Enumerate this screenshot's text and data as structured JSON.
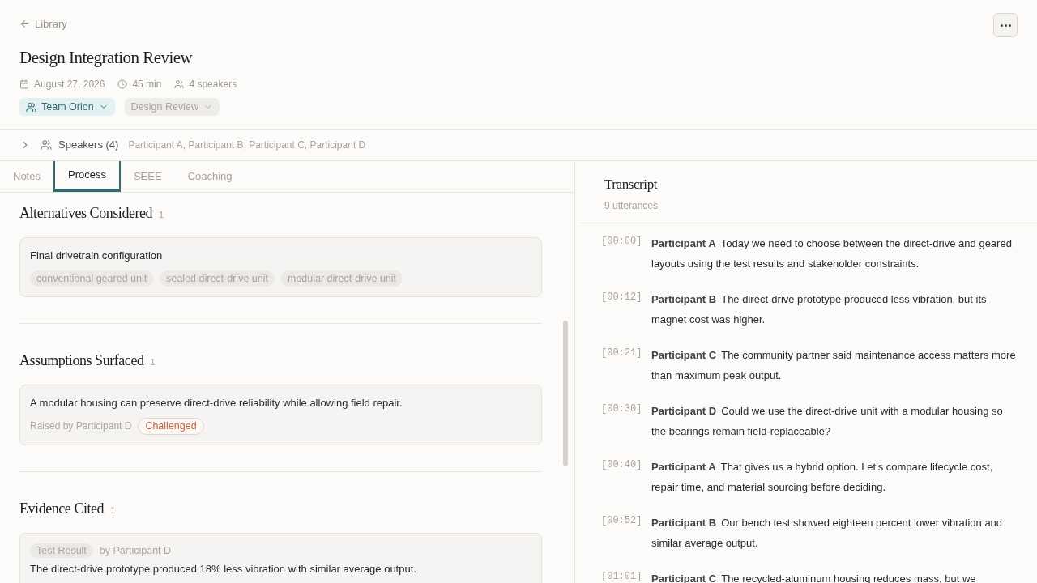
{
  "back_link": "Library",
  "title": "Design Integration Review",
  "meta": {
    "date": "August 27, 2026",
    "duration": "45 min",
    "speakers": "4 speakers"
  },
  "tags": [
    {
      "kind": "team",
      "label": "Team Orion"
    },
    {
      "kind": "type",
      "label": "Design Review"
    }
  ],
  "speakers_row": {
    "expanded": false,
    "label": "Speakers (4)",
    "names": "Participant A, Participant B, Participant C, Participant D"
  },
  "tabs": [
    {
      "label": "Notes",
      "selected": false
    },
    {
      "label": "Process",
      "selected": true
    },
    {
      "label": "SEEE",
      "selected": false
    },
    {
      "label": "Coaching",
      "selected": false
    }
  ],
  "sections": [
    {
      "kind": "alternatives",
      "title": "Alternatives Considered",
      "count": "1",
      "items": [
        {
          "text": "Final drivetrain configuration",
          "options": [
            "conventional geared unit",
            "sealed direct-drive unit",
            "modular direct-drive unit"
          ]
        }
      ]
    },
    {
      "kind": "assumptions",
      "title": "Assumptions Surfaced",
      "count": "1",
      "items": [
        {
          "text": "A modular housing can preserve direct-drive reliability while allowing field repair.",
          "raised_by": "Raised by Participant D",
          "status": "Challenged"
        }
      ]
    },
    {
      "kind": "evidence",
      "title": "Evidence Cited",
      "count": "1",
      "items": [
        {
          "tag": "Test Result",
          "by": "by Participant D",
          "text": "The direct-drive prototype produced 18% less vibration with similar average output."
        }
      ]
    }
  ],
  "transcript": {
    "title": "Transcript",
    "subtitle": "9 utterances",
    "utterances": [
      {
        "time": "[00:00]",
        "speaker": "Participant A",
        "text": "Today we need to choose between the direct-drive and geared layouts using the test results and stakeholder constraints."
      },
      {
        "time": "[00:12]",
        "speaker": "Participant B",
        "text": "The direct-drive prototype produced less vibration, but its magnet cost was higher."
      },
      {
        "time": "[00:21]",
        "speaker": "Participant C",
        "text": "The community partner said maintenance access matters more than maximum peak output."
      },
      {
        "time": "[00:30]",
        "speaker": "Participant D",
        "text": "Could we use the direct-drive unit with a modular housing so the bearings remain field-replaceable?"
      },
      {
        "time": "[00:40]",
        "speaker": "Participant A",
        "text": "That gives us a hybrid option. Let's compare lifecycle cost, repair time, and material sourcing before deciding."
      },
      {
        "time": "[00:52]",
        "speaker": "Participant B",
        "text": "Our bench test showed eighteen percent lower vibration and similar average output."
      },
      {
        "time": "[01:01]",
        "speaker": "Participant C",
        "text": "The recycled-aluminum housing reduces mass, but we"
      }
    ]
  }
}
